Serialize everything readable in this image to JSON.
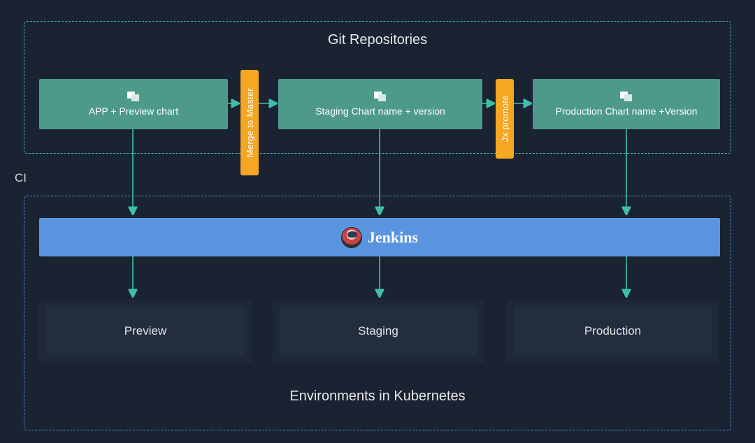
{
  "git": {
    "title": "Git Repositories",
    "repos": [
      {
        "label": "APP + Preview chart"
      },
      {
        "label": "Staging Chart name + version"
      },
      {
        "label": "Production Chart name +Version"
      }
    ],
    "pill_merge": "Merge to Master",
    "pill_jx": "Jx promote"
  },
  "ci_label": "CI",
  "jenkins": {
    "label": "Jenkins"
  },
  "envs": {
    "title": "Environments in Kubernetes",
    "items": [
      {
        "label": "Preview"
      },
      {
        "label": "Staging"
      },
      {
        "label": "Production"
      }
    ]
  }
}
